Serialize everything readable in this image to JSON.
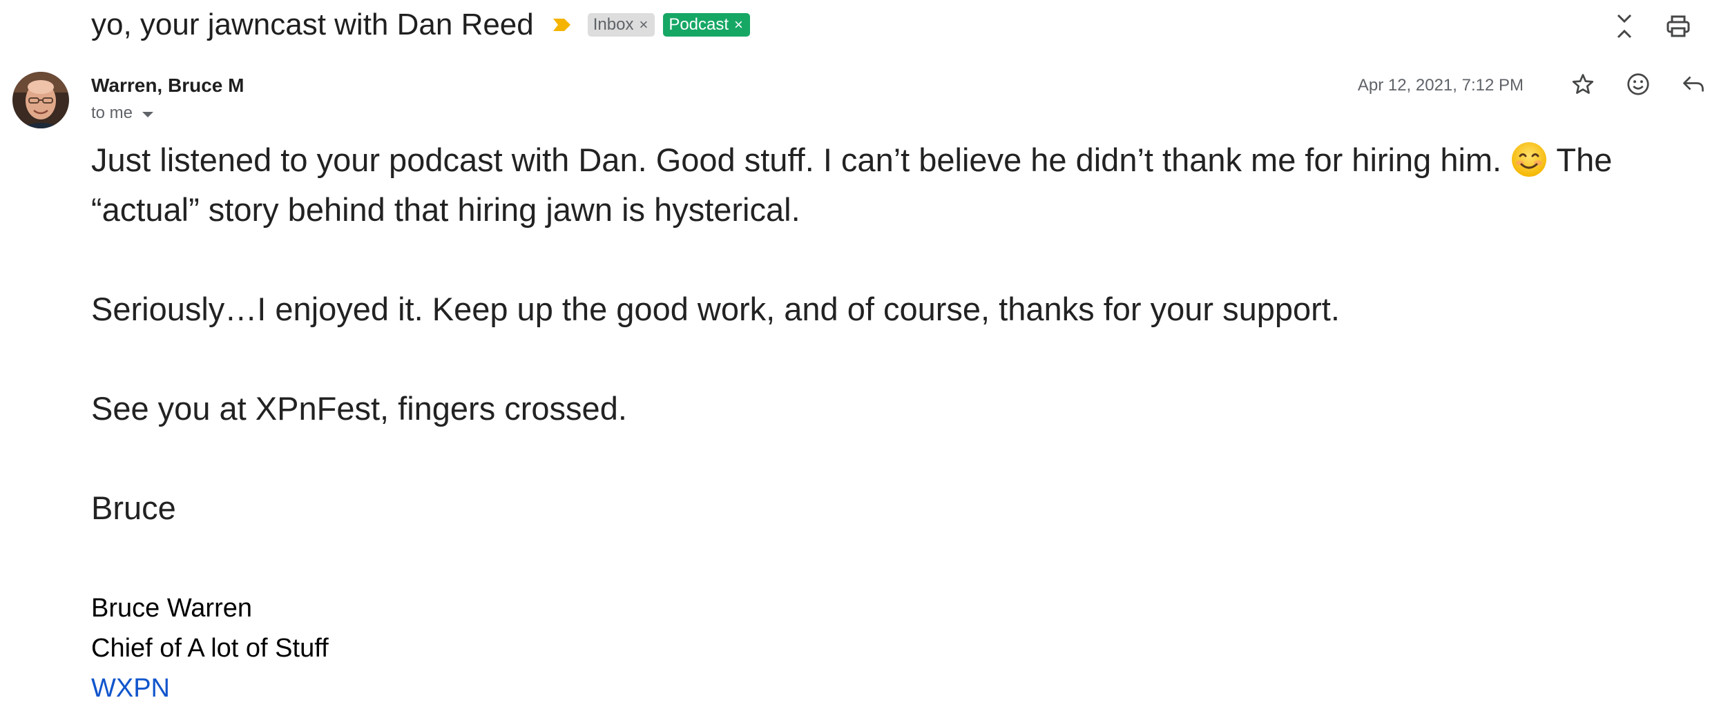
{
  "email": {
    "subject": "yo, your jawncast with Dan Reed",
    "labels": [
      {
        "name": "Inbox",
        "remove_glyph": "×"
      },
      {
        "name": "Podcast",
        "remove_glyph": "×",
        "color": "#16a765"
      }
    ],
    "sender": {
      "name": "Warren, Bruce M",
      "recipient": "to me"
    },
    "date": "Apr 12, 2021, 7:12 PM",
    "body": {
      "p1_before_emoji": "Just listened to your podcast with Dan. Good stuff. I can’t believe he didn’t thank me for hiring him.",
      "p1_after_emoji": "The “actual” story behind that hiring jawn is hysterical.",
      "p2": "Seriously…I enjoyed it. Keep up the good work, and of course, thanks for your support.",
      "p3": "See you at XPnFest, fingers crossed.",
      "p4": "Bruce"
    },
    "signature": {
      "name": "Bruce Warren",
      "title": "Chief of A lot of Stuff",
      "org_link": "WXPN"
    }
  },
  "icons": {
    "importance": "importance-marker-icon",
    "collapse": "collapse-all-icon",
    "print": "print-icon",
    "star": "star-icon",
    "emoji_reaction": "add-emoji-reaction-icon",
    "reply": "reply-icon",
    "dropdown": "chevron-down-icon"
  },
  "colors": {
    "importance": "#f4b400",
    "podcast_label": "#16a765",
    "inbox_label": "#dddddd",
    "link": "#1155cc"
  }
}
